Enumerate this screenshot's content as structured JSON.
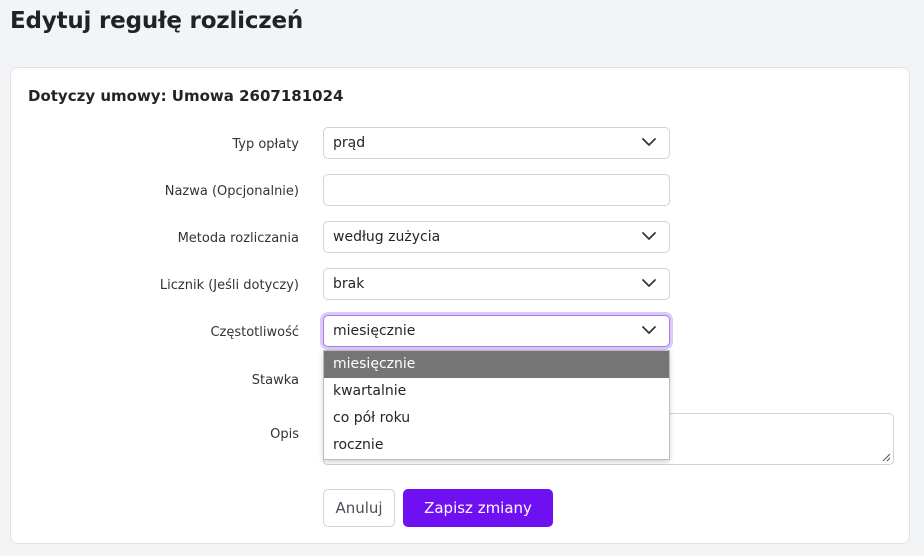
{
  "page": {
    "title": "Edytuj regułę rozliczeń"
  },
  "contract": {
    "title": "Dotyczy umowy: Umowa 2607181024"
  },
  "fields": {
    "fee_type": {
      "label": "Typ opłaty",
      "value": "prąd"
    },
    "name": {
      "label": "Nazwa (Opcjonalnie)",
      "value": ""
    },
    "method": {
      "label": "Metoda rozliczania",
      "value": "według zużycia"
    },
    "meter": {
      "label": "Licznik (Jeśli dotyczy)",
      "value": "brak"
    },
    "frequency": {
      "label": "Częstotliwość",
      "value": "miesięcznie",
      "options": [
        "miesięcznie",
        "kwartalnie",
        "co pół roku",
        "rocznie"
      ]
    },
    "rate": {
      "label": "Stawka"
    },
    "description": {
      "label": "Opis",
      "value": ""
    }
  },
  "buttons": {
    "cancel": "Anuluj",
    "save": "Zapisz zmiany"
  },
  "colors": {
    "primary": "#6f10f2",
    "focus_ring": "#ddc9f8",
    "selected_option": "#757575"
  },
  "icons": {
    "select_arrow": "chevron-down-icon",
    "resize": "resize-grip-icon"
  }
}
